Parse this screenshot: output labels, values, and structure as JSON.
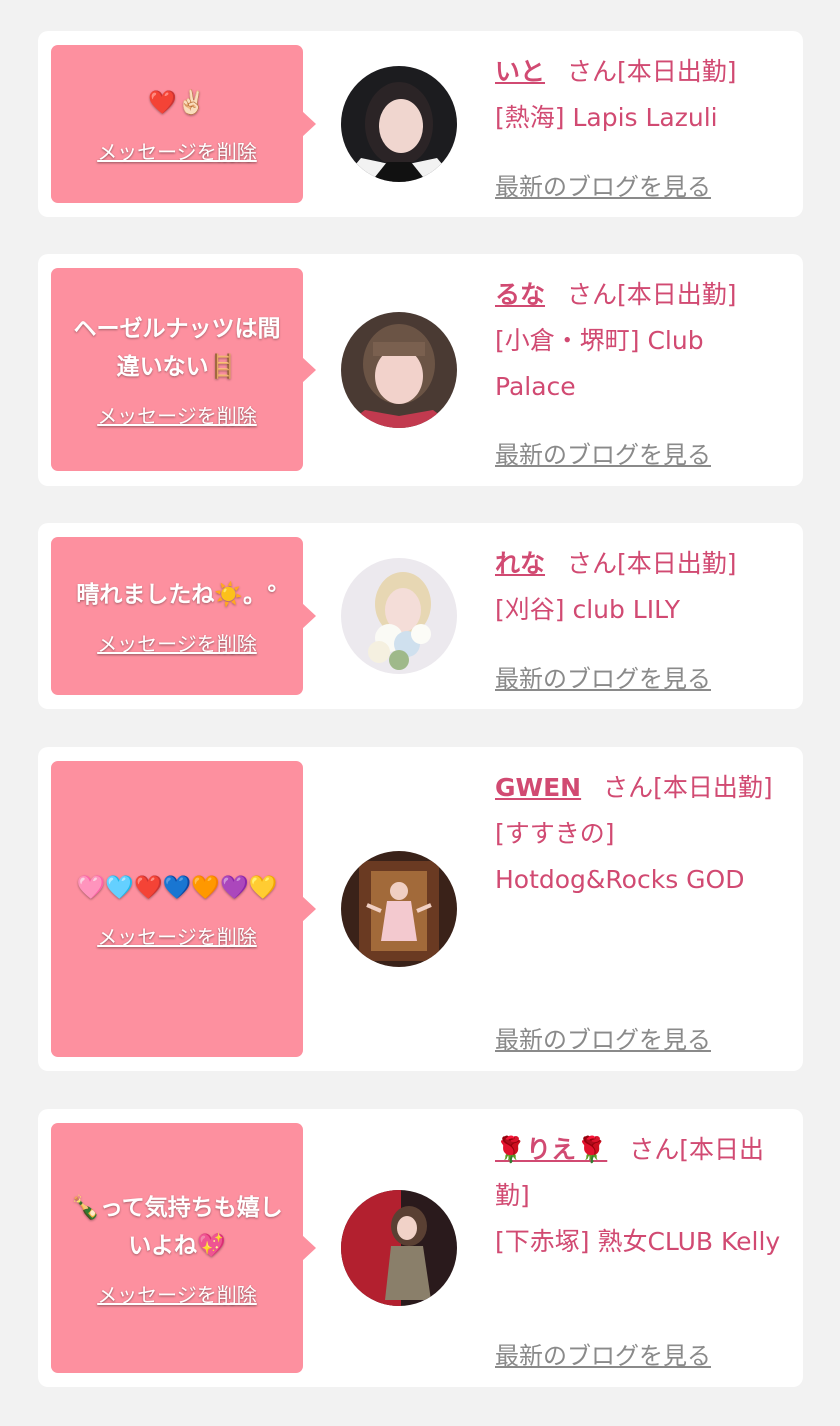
{
  "common": {
    "delete_label": "メッセージを削除",
    "blog_label": "最新のブログを見る",
    "suffix_label": "さん[本日出勤]"
  },
  "colors": {
    "background": "#f2f2f2",
    "card": "#ffffff",
    "bubble": "#fd909f",
    "accent_text": "#d14a72",
    "link_gray": "#8a8a8a"
  },
  "cards": [
    {
      "message": "❤️✌🏻",
      "name": "いと",
      "shop": "[熱海] Lapis Lazuli",
      "avatar_icon": "girl-portrait-icon"
    },
    {
      "message": "ヘーゼルナッツは間違いない🪜",
      "name": "るな",
      "shop": "[小倉・堺町] Club Palace",
      "avatar_icon": "girl-portrait-icon"
    },
    {
      "message": "晴れましたね☀️。°",
      "name": "れな",
      "shop": "[刈谷] club LILY",
      "avatar_icon": "girl-with-flowers-icon"
    },
    {
      "message": "🩷🩵❤️💙🧡💜💛",
      "name": "GWEN",
      "shop": "[すすきの] Hotdog&Rocks GOD",
      "avatar_icon": "girl-standing-icon"
    },
    {
      "message": "🍾って気持ちも嬉しいよね💖",
      "name": "🌹りえ🌹",
      "shop": "[下赤塚] 熟女CLUB Kelly",
      "avatar_icon": "girl-seated-icon"
    }
  ]
}
